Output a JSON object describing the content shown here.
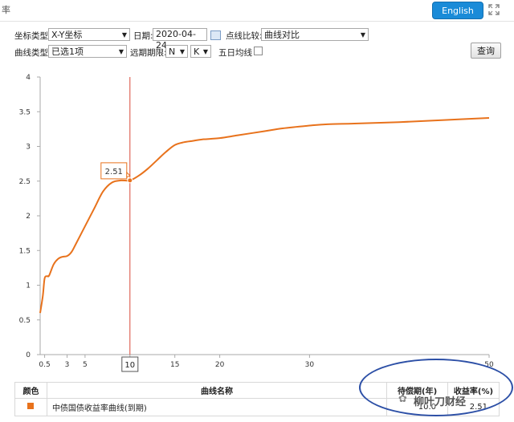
{
  "window": {
    "title_fragment": "率",
    "english_label": "English",
    "expand_icon": "expand-arrows-icon"
  },
  "controls": {
    "coord_type_label": "坐标类型:",
    "coord_type_value": "X-Y坐标",
    "date_label": "日期:",
    "date_value": "2020-04-24",
    "compare_label": "点线比较:",
    "compare_value": "曲线对比",
    "curve_type_label": "曲线类型:",
    "curve_type_value": "已选1项",
    "period_label": "远期期限:",
    "period_n": "N",
    "period_k": "K",
    "five_day_label": "五日均线",
    "query_label": "查询"
  },
  "chart_data": {
    "type": "line",
    "xlabel": "",
    "ylabel": "",
    "xlim": [
      0,
      50
    ],
    "ylim": [
      0,
      4
    ],
    "y_ticks": [
      "0",
      "0.5",
      "1",
      "1.5",
      "2",
      "2.5",
      "3",
      "3.5",
      "4"
    ],
    "x_ticks": [
      "0.5",
      "3",
      "5",
      "10",
      "15",
      "20",
      "30",
      "50"
    ],
    "x_tick_values": [
      0.5,
      3,
      5,
      10,
      15,
      20,
      30,
      50
    ],
    "series": [
      {
        "name": "中债国债收益率曲线(到期)",
        "color": "#e8721c",
        "x": [
          0,
          0.3,
          0.5,
          0.8,
          1,
          1.5,
          2,
          2.5,
          3,
          3.5,
          4,
          5,
          6,
          7,
          8,
          9,
          10,
          11,
          12,
          13,
          14,
          15,
          16,
          17,
          18,
          20,
          22,
          25,
          27,
          30,
          32,
          35,
          40,
          45,
          50
        ],
        "y": [
          0.6,
          0.85,
          1.1,
          1.13,
          1.14,
          1.3,
          1.38,
          1.41,
          1.42,
          1.48,
          1.6,
          1.85,
          2.1,
          2.35,
          2.48,
          2.51,
          2.51,
          2.58,
          2.68,
          2.8,
          2.92,
          3.02,
          3.06,
          3.08,
          3.1,
          3.12,
          3.16,
          3.22,
          3.26,
          3.3,
          3.32,
          3.33,
          3.35,
          3.38,
          3.41
        ]
      }
    ],
    "marker": {
      "x": 10,
      "label": "2.51",
      "x_label": "10",
      "color": "#d94a3a"
    },
    "grid": false,
    "legend": "none"
  },
  "table": {
    "headers": [
      "颜色",
      "曲线名称",
      "待偿期(年)",
      "收益率(%)"
    ],
    "rows": [
      {
        "color": "#e8721c",
        "name": "中债国债收益率曲线(到期)",
        "term": "10.0",
        "yield": "2.51"
      }
    ]
  },
  "watermark": {
    "text": "柳叶刀财经"
  }
}
